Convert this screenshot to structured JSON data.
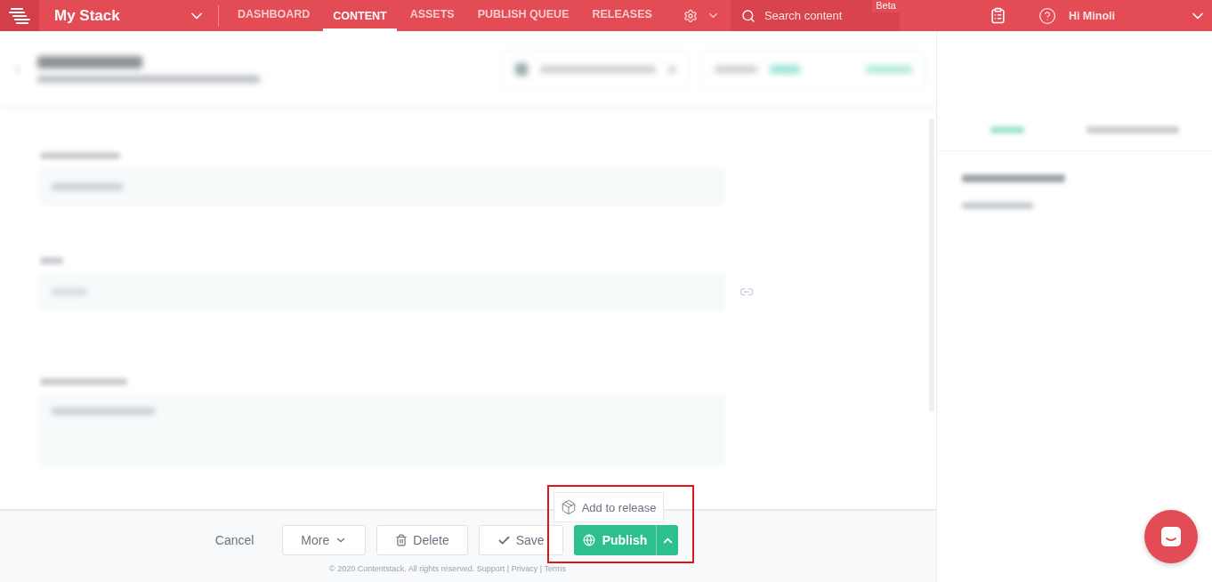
{
  "topbar": {
    "stack_name": "My Stack",
    "nav": [
      {
        "label": "DASHBOARD",
        "selected": false
      },
      {
        "label": "CONTENT",
        "selected": true
      },
      {
        "label": "ASSETS",
        "selected": false
      },
      {
        "label": "PUBLISH QUEUE",
        "selected": false
      },
      {
        "label": "RELEASES",
        "selected": false
      }
    ],
    "search": {
      "placeholder": "Search content",
      "badge": "Beta"
    },
    "greeting": "Hi",
    "user": "Minoli"
  },
  "footer": {
    "buttons": [
      {
        "kind": "link",
        "label": "Cancel"
      },
      {
        "kind": "menu",
        "label": "More"
      },
      {
        "kind": "delete",
        "label": "Delete"
      },
      {
        "kind": "save",
        "label": "Save"
      },
      {
        "kind": "publish",
        "label": "Publish"
      }
    ],
    "popup": {
      "label": "Add to release"
    },
    "legal": "© 2020 Contentstack. All rights reserved.",
    "links": [
      "Support",
      "Privacy",
      "Terms"
    ],
    "link_separator": "|"
  }
}
